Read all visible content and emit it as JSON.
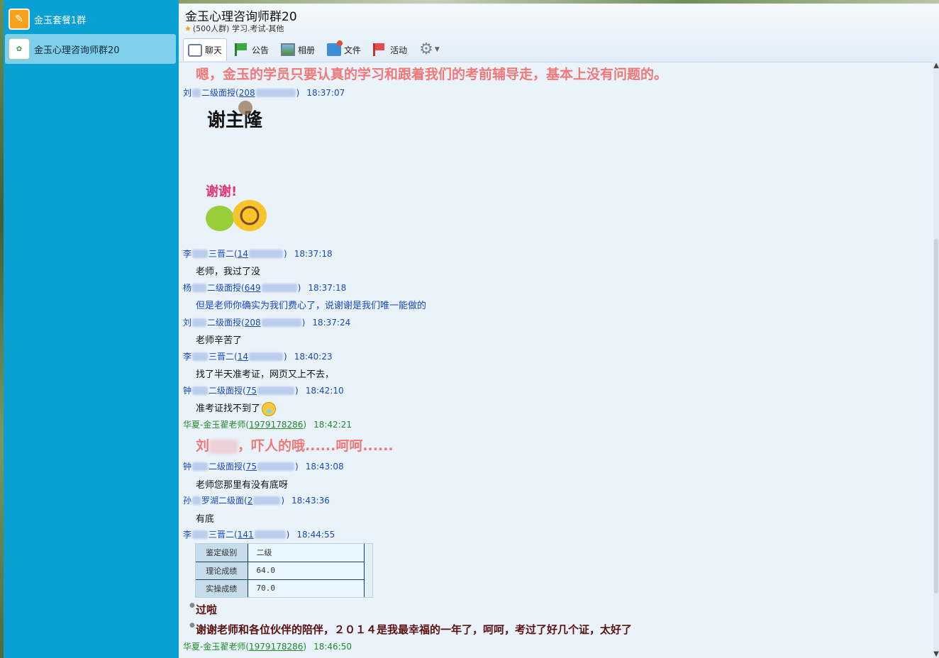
{
  "sessions": [
    {
      "name": "金玉套餐1群",
      "icon": "group-avatar-icon"
    },
    {
      "name": "金玉心理咨询师群20",
      "icon": "group-logo-icon"
    }
  ],
  "header": {
    "title": "金玉心理咨询师群20",
    "subtitle": "(500人群) 学习.考试-其他"
  },
  "toolbar": {
    "chat": "聊天",
    "notice": "公告",
    "album": "相册",
    "files": "文件",
    "activity": "活动"
  },
  "messages": {
    "m0": "嗯，金玉的学员只要认真的学习和跟着我们的考前辅导走，基本上没有问题的。",
    "s1": {
      "name": "刘",
      "mid": "二级面授",
      "uid": "208",
      "time": "18:37:07"
    },
    "s2": {
      "name": "李",
      "mid": "三晋二",
      "uid": "14",
      "time": "18:37:18"
    },
    "m2": "老师，我过了没",
    "s3": {
      "name": "杨",
      "mid": "二级面授",
      "uid": "649",
      "time": "18:37:18"
    },
    "m3": "但是老师你确实为我们费心了，说谢谢是我们唯一能做的",
    "s4": {
      "name": "刘",
      "mid": "二级面授",
      "uid": "208",
      "time": "18:37:24"
    },
    "m4": "老师辛苦了",
    "s5": {
      "name": "李",
      "mid": "三晋二",
      "uid": "14",
      "time": "18:40:23"
    },
    "m5": "找了半天准考证，网页又上不去，",
    "s6": {
      "name": "钟",
      "mid": "二级面授",
      "uid": "75",
      "time": "18:42:10"
    },
    "m6": "准考证找不到了",
    "s7": {
      "name": "华夏-金玉翟老师",
      "uid": "1979178286",
      "time": "18:42:21"
    },
    "m7a": "刘",
    "m7b": "，吓人的哦......呵呵......",
    "s8": {
      "name": "钟",
      "mid": "二级面授",
      "uid": "75",
      "time": "18:43:08"
    },
    "m8": "老师您那里有没有底呀",
    "s9": {
      "name": "孙",
      "mid": "罗湖二级面",
      "uid": "2",
      "time": "18:43:36"
    },
    "m9": "有底",
    "s10": {
      "name": "李",
      "mid": "三晋二",
      "uid": "141",
      "time": "18:44:55"
    },
    "score": {
      "rows": [
        {
          "k": "鉴定级别",
          "v": "二级"
        },
        {
          "k": "理论成绩",
          "v": "64.0"
        },
        {
          "k": "实操成绩",
          "v": "70.0"
        }
      ]
    },
    "m10a": "过啦",
    "m10b": "谢谢老师和各位伙伴的陪伴，２０１４是我最幸福的一年了，呵呵，考过了好几个证，太好了",
    "s11": {
      "name": "华夏-金玉翟老师",
      "uid": "1979178286",
      "time": "18:46:50"
    }
  },
  "stickers": {
    "s1_text": "谢主隆恩",
    "s2_text": "谢谢!"
  },
  "colors": {
    "sidebar": "#0aa0d4",
    "sender_blue": "#1747c9",
    "teacher_green": "#1f8a2c",
    "highlight_red": "#f07878",
    "dark_red": "#5a1010"
  }
}
